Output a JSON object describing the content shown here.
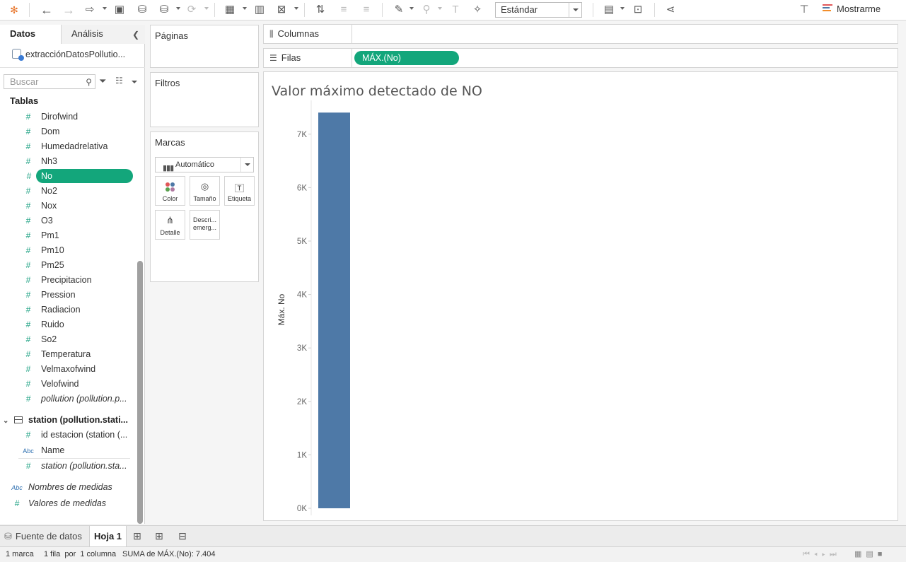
{
  "toolbar": {
    "fit_value": "Estándar",
    "show_me_label": "Mostrarme",
    "icons": [
      "tableau-logo-icon",
      "undo-icon",
      "redo-icon",
      "redirect-icon",
      "save-icon",
      "new-datasource-icon",
      "pause-updates-icon",
      "refresh-icon",
      "new-worksheet-icon",
      "duplicate-icon",
      "clear-icon",
      "swap-icon",
      "sort-asc-icon",
      "sort-desc-icon",
      "highlight-icon",
      "group-icon",
      "label-icon",
      "pin-icon",
      "cards-icon",
      "presentation-icon",
      "share-icon",
      "pushpin-icon"
    ]
  },
  "data_pane": {
    "tab_data": "Datos",
    "tab_analysis": "Análisis",
    "datasource_name": "extracciónDatosPollutio...",
    "search_placeholder": "Buscar",
    "tables_heading": "Tablas",
    "fields": [
      {
        "label": "Dirofwind",
        "type": "measure"
      },
      {
        "label": "Dom",
        "type": "measure"
      },
      {
        "label": "Humedadrelativa",
        "type": "measure"
      },
      {
        "label": "Nh3",
        "type": "measure"
      },
      {
        "label": "No",
        "type": "measure",
        "selected": true
      },
      {
        "label": "No2",
        "type": "measure"
      },
      {
        "label": "Nox",
        "type": "measure"
      },
      {
        "label": "O3",
        "type": "measure"
      },
      {
        "label": "Pm1",
        "type": "measure"
      },
      {
        "label": "Pm10",
        "type": "measure"
      },
      {
        "label": "Pm25",
        "type": "measure"
      },
      {
        "label": "Precipitacion",
        "type": "measure"
      },
      {
        "label": "Pression",
        "type": "measure"
      },
      {
        "label": "Radiacion",
        "type": "measure"
      },
      {
        "label": "Ruido",
        "type": "measure"
      },
      {
        "label": "So2",
        "type": "measure"
      },
      {
        "label": "Temperatura",
        "type": "measure"
      },
      {
        "label": "Velmaxofwind",
        "type": "measure"
      },
      {
        "label": "Velofwind",
        "type": "measure"
      },
      {
        "label": "pollution (pollution.p...",
        "type": "measure",
        "italic": true
      }
    ],
    "station_table": "station (pollution.stati...",
    "station_fields": [
      {
        "label": "id estacion (station (...",
        "type": "measure"
      },
      {
        "label": "Name",
        "type": "dimension"
      },
      {
        "label": "station (pollution.sta...",
        "type": "measure",
        "italic": true
      }
    ],
    "measure_names": "Nombres de medidas",
    "measure_values": "Valores de medidas",
    "abc_badge": "Abc"
  },
  "cards": {
    "pages": "Páginas",
    "filters": "Filtros",
    "marks": "Marcas",
    "mark_type": "Automático",
    "mark_buttons": [
      {
        "label": "Color",
        "icon": "color-icon"
      },
      {
        "label": "Tamaño",
        "icon": "size-icon"
      },
      {
        "label": "Etiqueta",
        "icon": "label-icon"
      },
      {
        "label": "Detalle",
        "icon": "detail-icon"
      },
      {
        "label": "Descri... emerg...",
        "icon": "tooltip-icon"
      }
    ]
  },
  "shelves": {
    "columns_label": "Columnas",
    "rows_label": "Filas",
    "rows_pill": "MÁX.(No)"
  },
  "viz": {
    "title": "Valor máximo detectado de NO"
  },
  "chart_data": {
    "type": "bar",
    "title": "Valor máximo detectado de NO",
    "xlabel": "",
    "ylabel": "Máx. No",
    "categories": [
      ""
    ],
    "values": [
      7404
    ],
    "ylim": [
      0,
      7500
    ],
    "yticks": [
      0,
      1000,
      2000,
      3000,
      4000,
      5000,
      6000,
      7000
    ],
    "ytick_labels": [
      "0K",
      "1K",
      "2K",
      "3K",
      "4K",
      "5K",
      "6K",
      "7K"
    ],
    "bar_color": "#4e79a7",
    "grid": false
  },
  "sheet_bar": {
    "datasource_tab": "Fuente de datos",
    "sheet_tab": "Hoja 1"
  },
  "status_bar": {
    "marks": "1 marca",
    "rows_cols": "1 fila  por  1 columna",
    "summary": "SUMA de MÁX.(No): 7.404"
  },
  "colors": {
    "accent_green": "#13a67b",
    "bar_blue": "#4e79a7"
  }
}
